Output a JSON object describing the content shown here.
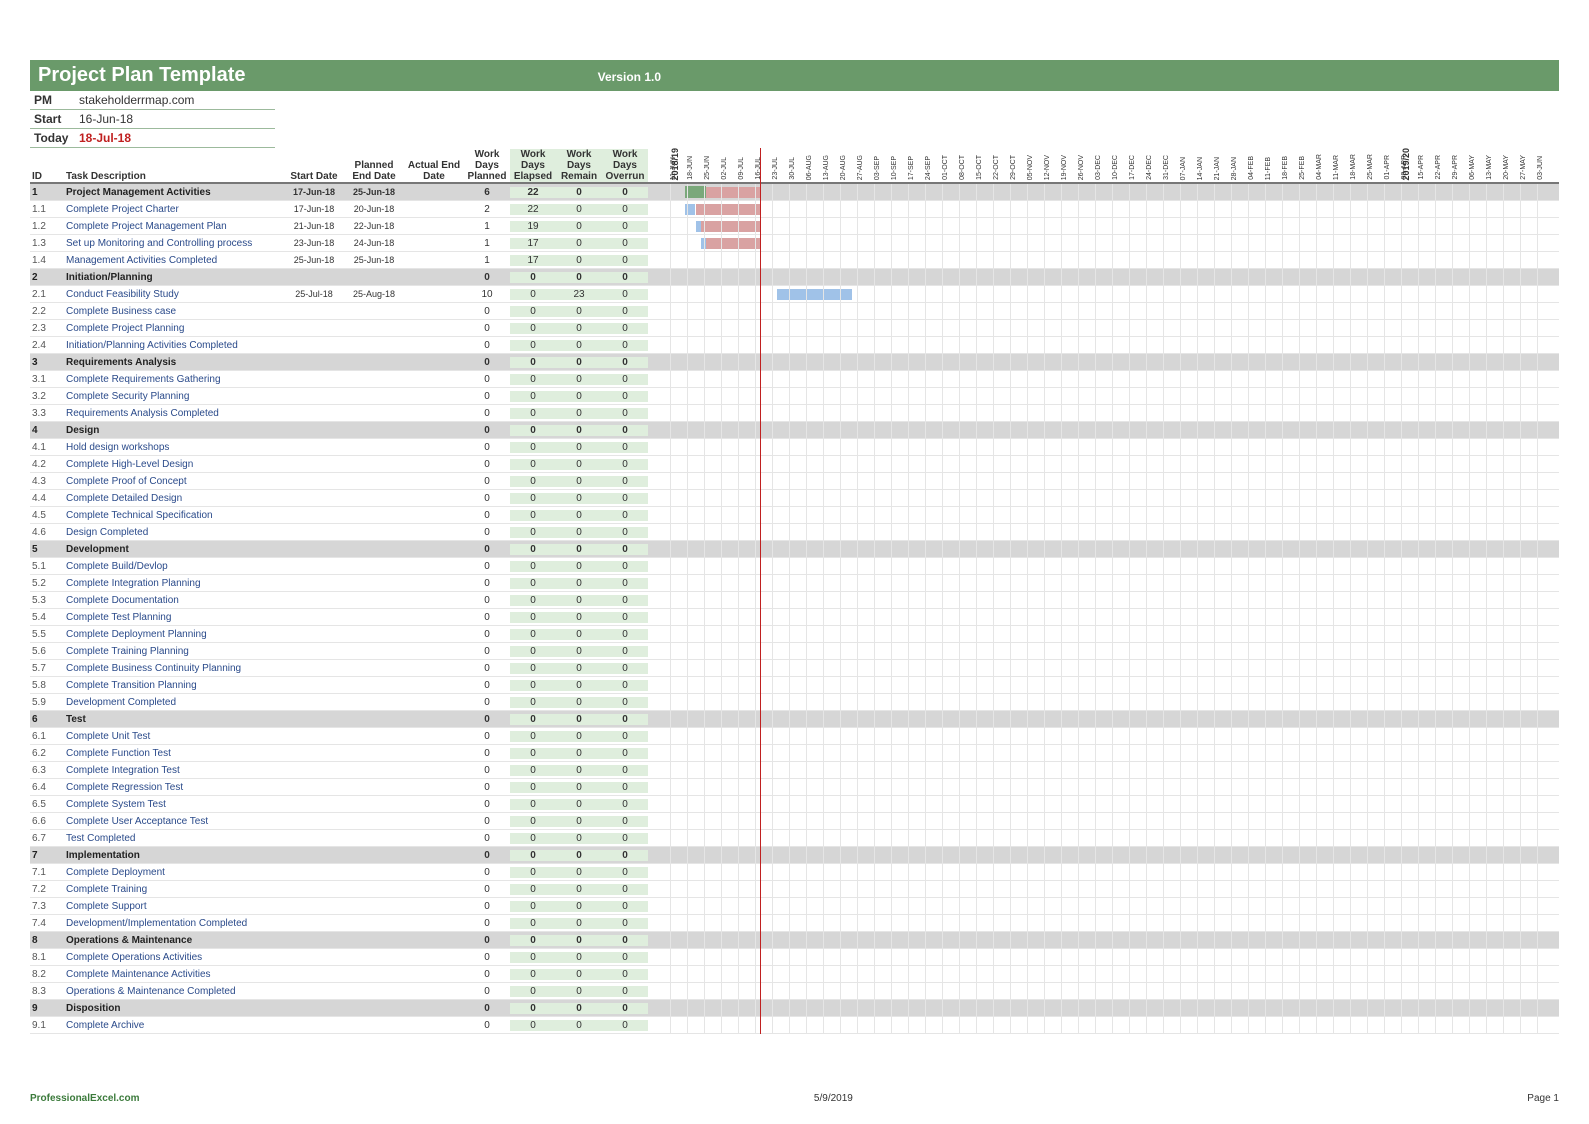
{
  "title": "Project Plan Template",
  "version": "Version 1.0",
  "meta": {
    "pm_label": "PM",
    "pm_value": "stakeholderrmap.com",
    "start_label": "Start",
    "start_value": "16-Jun-18",
    "today_label": "Today",
    "today_value": "18-Jul-18"
  },
  "headers": {
    "id": "ID",
    "desc": "Task Description",
    "start": "Start Date",
    "planned_end": "Planned End Date",
    "actual_end": "Actual End Date",
    "wdp": "Work Days Planned",
    "wde": "Work Days Elapsed",
    "wdr": "Work Days Remain",
    "wdo": "Work Days Overrun"
  },
  "timeline": {
    "years": [
      {
        "label": "2018/19",
        "weekIndex": 0
      },
      {
        "label": "2019/20",
        "weekIndex": 43
      }
    ],
    "weeks": [
      "11-JUN",
      "18-JUN",
      "25-JUN",
      "02-JUL",
      "09-JUL",
      "16-JUL",
      "23-JUL",
      "30-JUL",
      "06-AUG",
      "13-AUG",
      "20-AUG",
      "27-AUG",
      "03-SEP",
      "10-SEP",
      "17-SEP",
      "24-SEP",
      "01-OCT",
      "08-OCT",
      "15-OCT",
      "22-OCT",
      "29-OCT",
      "05-NOV",
      "12-NOV",
      "19-NOV",
      "26-NOV",
      "03-DEC",
      "10-DEC",
      "17-DEC",
      "24-DEC",
      "31-DEC",
      "07-JAN",
      "14-JAN",
      "21-JAN",
      "28-JAN",
      "04-FEB",
      "11-FEB",
      "18-FEB",
      "25-FEB",
      "04-MAR",
      "11-MAR",
      "18-MAR",
      "25-MAR",
      "01-APR",
      "08-APR",
      "15-APR",
      "22-APR",
      "29-APR",
      "06-MAY",
      "13-MAY",
      "20-MAY",
      "27-MAY",
      "03-JUN"
    ],
    "weekWidth": 17,
    "todayWeekOffset": 5.3
  },
  "rows": [
    {
      "id": "1",
      "phase": true,
      "desc": "Project Management Activities",
      "sd": "17-Jun-18",
      "ped": "25-Jun-18",
      "aed": "",
      "wp": "6",
      "we": "22",
      "wr": "0",
      "wo": "0",
      "bar": {
        "start": 0.9,
        "len": 1.2,
        "type": "phaseBar"
      },
      "over": {
        "start": 2.1,
        "len": 3.2
      }
    },
    {
      "id": "1.1",
      "phase": false,
      "desc": "Complete Project Charter",
      "sd": "17-Jun-18",
      "ped": "20-Jun-18",
      "aed": "",
      "wp": "2",
      "we": "22",
      "wr": "0",
      "wo": "0",
      "bar": {
        "start": 0.9,
        "len": 0.6,
        "type": "plan"
      },
      "over": {
        "start": 1.5,
        "len": 3.8
      }
    },
    {
      "id": "1.2",
      "phase": false,
      "desc": "Complete Project Management Plan",
      "sd": "21-Jun-18",
      "ped": "22-Jun-18",
      "aed": "",
      "wp": "1",
      "we": "19",
      "wr": "0",
      "wo": "0",
      "bar": {
        "start": 1.5,
        "len": 0.3,
        "type": "plan"
      },
      "over": {
        "start": 1.8,
        "len": 3.5
      }
    },
    {
      "id": "1.3",
      "phase": false,
      "desc": "Set up Monitoring and Controlling process",
      "sd": "23-Jun-18",
      "ped": "24-Jun-18",
      "aed": "",
      "wp": "1",
      "we": "17",
      "wr": "0",
      "wo": "0",
      "bar": {
        "start": 1.8,
        "len": 0.3,
        "type": "plan"
      },
      "over": {
        "start": 2.1,
        "len": 3.2
      }
    },
    {
      "id": "1.4",
      "phase": false,
      "desc": "Management Activities Completed",
      "sd": "25-Jun-18",
      "ped": "25-Jun-18",
      "aed": "",
      "wp": "1",
      "we": "17",
      "wr": "0",
      "wo": "0"
    },
    {
      "id": "2",
      "phase": true,
      "desc": "Initiation/Planning",
      "sd": "",
      "ped": "",
      "aed": "",
      "wp": "0",
      "we": "0",
      "wr": "0",
      "wo": "0"
    },
    {
      "id": "2.1",
      "phase": false,
      "desc": "Conduct Feasibility Study",
      "sd": "25-Jul-18",
      "ped": "25-Aug-18",
      "aed": "",
      "wp": "10",
      "we": "0",
      "wr": "23",
      "wo": "0",
      "bar": {
        "start": 6.3,
        "len": 4.4,
        "type": "plan"
      }
    },
    {
      "id": "2.2",
      "phase": false,
      "desc": "Complete Business case",
      "sd": "",
      "ped": "",
      "aed": "",
      "wp": "0",
      "we": "0",
      "wr": "0",
      "wo": "0"
    },
    {
      "id": "2.3",
      "phase": false,
      "desc": "Complete Project Planning",
      "sd": "",
      "ped": "",
      "aed": "",
      "wp": "0",
      "we": "0",
      "wr": "0",
      "wo": "0"
    },
    {
      "id": "2.4",
      "phase": false,
      "desc": "Initiation/Planning Activities Completed",
      "sd": "",
      "ped": "",
      "aed": "",
      "wp": "0",
      "we": "0",
      "wr": "0",
      "wo": "0"
    },
    {
      "id": "3",
      "phase": true,
      "desc": "Requirements Analysis",
      "sd": "",
      "ped": "",
      "aed": "",
      "wp": "0",
      "we": "0",
      "wr": "0",
      "wo": "0"
    },
    {
      "id": "3.1",
      "phase": false,
      "desc": "Complete Requirements Gathering",
      "sd": "",
      "ped": "",
      "aed": "",
      "wp": "0",
      "we": "0",
      "wr": "0",
      "wo": "0"
    },
    {
      "id": "3.2",
      "phase": false,
      "desc": "Complete Security Planning",
      "sd": "",
      "ped": "",
      "aed": "",
      "wp": "0",
      "we": "0",
      "wr": "0",
      "wo": "0"
    },
    {
      "id": "3.3",
      "phase": false,
      "desc": "Requirements Analysis Completed",
      "sd": "",
      "ped": "",
      "aed": "",
      "wp": "0",
      "we": "0",
      "wr": "0",
      "wo": "0"
    },
    {
      "id": "4",
      "phase": true,
      "desc": "Design",
      "sd": "",
      "ped": "",
      "aed": "",
      "wp": "0",
      "we": "0",
      "wr": "0",
      "wo": "0"
    },
    {
      "id": "4.1",
      "phase": false,
      "desc": "Hold design workshops",
      "sd": "",
      "ped": "",
      "aed": "",
      "wp": "0",
      "we": "0",
      "wr": "0",
      "wo": "0"
    },
    {
      "id": "4.2",
      "phase": false,
      "desc": "Complete High-Level Design",
      "sd": "",
      "ped": "",
      "aed": "",
      "wp": "0",
      "we": "0",
      "wr": "0",
      "wo": "0"
    },
    {
      "id": "4.3",
      "phase": false,
      "desc": "Complete Proof of Concept",
      "sd": "",
      "ped": "",
      "aed": "",
      "wp": "0",
      "we": "0",
      "wr": "0",
      "wo": "0"
    },
    {
      "id": "4.4",
      "phase": false,
      "desc": "Complete Detailed Design",
      "sd": "",
      "ped": "",
      "aed": "",
      "wp": "0",
      "we": "0",
      "wr": "0",
      "wo": "0"
    },
    {
      "id": "4.5",
      "phase": false,
      "desc": "Complete Technical Specification",
      "sd": "",
      "ped": "",
      "aed": "",
      "wp": "0",
      "we": "0",
      "wr": "0",
      "wo": "0"
    },
    {
      "id": "4.6",
      "phase": false,
      "desc": "Design Completed",
      "sd": "",
      "ped": "",
      "aed": "",
      "wp": "0",
      "we": "0",
      "wr": "0",
      "wo": "0"
    },
    {
      "id": "5",
      "phase": true,
      "desc": "Development",
      "sd": "",
      "ped": "",
      "aed": "",
      "wp": "0",
      "we": "0",
      "wr": "0",
      "wo": "0"
    },
    {
      "id": "5.1",
      "phase": false,
      "desc": "Complete Build/Devlop",
      "sd": "",
      "ped": "",
      "aed": "",
      "wp": "0",
      "we": "0",
      "wr": "0",
      "wo": "0"
    },
    {
      "id": "5.2",
      "phase": false,
      "desc": "Complete Integration Planning",
      "sd": "",
      "ped": "",
      "aed": "",
      "wp": "0",
      "we": "0",
      "wr": "0",
      "wo": "0"
    },
    {
      "id": "5.3",
      "phase": false,
      "desc": "Complete Documentation",
      "sd": "",
      "ped": "",
      "aed": "",
      "wp": "0",
      "we": "0",
      "wr": "0",
      "wo": "0"
    },
    {
      "id": "5.4",
      "phase": false,
      "desc": "Complete Test Planning",
      "sd": "",
      "ped": "",
      "aed": "",
      "wp": "0",
      "we": "0",
      "wr": "0",
      "wo": "0"
    },
    {
      "id": "5.5",
      "phase": false,
      "desc": "Complete Deployment Planning",
      "sd": "",
      "ped": "",
      "aed": "",
      "wp": "0",
      "we": "0",
      "wr": "0",
      "wo": "0"
    },
    {
      "id": "5.6",
      "phase": false,
      "desc": "Complete Training Planning",
      "sd": "",
      "ped": "",
      "aed": "",
      "wp": "0",
      "we": "0",
      "wr": "0",
      "wo": "0"
    },
    {
      "id": "5.7",
      "phase": false,
      "desc": "Complete Business Continuity Planning",
      "sd": "",
      "ped": "",
      "aed": "",
      "wp": "0",
      "we": "0",
      "wr": "0",
      "wo": "0"
    },
    {
      "id": "5.8",
      "phase": false,
      "desc": "Complete Transition Planning",
      "sd": "",
      "ped": "",
      "aed": "",
      "wp": "0",
      "we": "0",
      "wr": "0",
      "wo": "0"
    },
    {
      "id": "5.9",
      "phase": false,
      "desc": "Development Completed",
      "sd": "",
      "ped": "",
      "aed": "",
      "wp": "0",
      "we": "0",
      "wr": "0",
      "wo": "0"
    },
    {
      "id": "6",
      "phase": true,
      "desc": "Test",
      "sd": "",
      "ped": "",
      "aed": "",
      "wp": "0",
      "we": "0",
      "wr": "0",
      "wo": "0"
    },
    {
      "id": "6.1",
      "phase": false,
      "desc": "Complete Unit Test",
      "sd": "",
      "ped": "",
      "aed": "",
      "wp": "0",
      "we": "0",
      "wr": "0",
      "wo": "0"
    },
    {
      "id": "6.2",
      "phase": false,
      "desc": "Complete Function Test",
      "sd": "",
      "ped": "",
      "aed": "",
      "wp": "0",
      "we": "0",
      "wr": "0",
      "wo": "0"
    },
    {
      "id": "6.3",
      "phase": false,
      "desc": "Complete Integration Test",
      "sd": "",
      "ped": "",
      "aed": "",
      "wp": "0",
      "we": "0",
      "wr": "0",
      "wo": "0"
    },
    {
      "id": "6.4",
      "phase": false,
      "desc": "Complete Regression Test",
      "sd": "",
      "ped": "",
      "aed": "",
      "wp": "0",
      "we": "0",
      "wr": "0",
      "wo": "0"
    },
    {
      "id": "6.5",
      "phase": false,
      "desc": "Complete System Test",
      "sd": "",
      "ped": "",
      "aed": "",
      "wp": "0",
      "we": "0",
      "wr": "0",
      "wo": "0"
    },
    {
      "id": "6.6",
      "phase": false,
      "desc": "Complete User Acceptance Test",
      "sd": "",
      "ped": "",
      "aed": "",
      "wp": "0",
      "we": "0",
      "wr": "0",
      "wo": "0"
    },
    {
      "id": "6.7",
      "phase": false,
      "desc": "Test Completed",
      "sd": "",
      "ped": "",
      "aed": "",
      "wp": "0",
      "we": "0",
      "wr": "0",
      "wo": "0"
    },
    {
      "id": "7",
      "phase": true,
      "desc": "Implementation",
      "sd": "",
      "ped": "",
      "aed": "",
      "wp": "0",
      "we": "0",
      "wr": "0",
      "wo": "0"
    },
    {
      "id": "7.1",
      "phase": false,
      "desc": "Complete Deployment",
      "sd": "",
      "ped": "",
      "aed": "",
      "wp": "0",
      "we": "0",
      "wr": "0",
      "wo": "0"
    },
    {
      "id": "7.2",
      "phase": false,
      "desc": "Complete Training",
      "sd": "",
      "ped": "",
      "aed": "",
      "wp": "0",
      "we": "0",
      "wr": "0",
      "wo": "0"
    },
    {
      "id": "7.3",
      "phase": false,
      "desc": "Complete  Support",
      "sd": "",
      "ped": "",
      "aed": "",
      "wp": "0",
      "we": "0",
      "wr": "0",
      "wo": "0"
    },
    {
      "id": "7.4",
      "phase": false,
      "desc": "Development/Implementation Completed",
      "sd": "",
      "ped": "",
      "aed": "",
      "wp": "0",
      "we": "0",
      "wr": "0",
      "wo": "0"
    },
    {
      "id": "8",
      "phase": true,
      "desc": "Operations & Maintenance",
      "sd": "",
      "ped": "",
      "aed": "",
      "wp": "0",
      "we": "0",
      "wr": "0",
      "wo": "0"
    },
    {
      "id": "8.1",
      "phase": false,
      "desc": "Complete Operations Activities",
      "sd": "",
      "ped": "",
      "aed": "",
      "wp": "0",
      "we": "0",
      "wr": "0",
      "wo": "0"
    },
    {
      "id": "8.2",
      "phase": false,
      "desc": "Complete Maintenance Activities",
      "sd": "",
      "ped": "",
      "aed": "",
      "wp": "0",
      "we": "0",
      "wr": "0",
      "wo": "0"
    },
    {
      "id": "8.3",
      "phase": false,
      "desc": "Operations & Maintenance Completed",
      "sd": "",
      "ped": "",
      "aed": "",
      "wp": "0",
      "we": "0",
      "wr": "0",
      "wo": "0"
    },
    {
      "id": "9",
      "phase": true,
      "desc": "Disposition",
      "sd": "",
      "ped": "",
      "aed": "",
      "wp": "0",
      "we": "0",
      "wr": "0",
      "wo": "0"
    },
    {
      "id": "9.1",
      "phase": false,
      "desc": "Complete Archive",
      "sd": "",
      "ped": "",
      "aed": "",
      "wp": "0",
      "we": "0",
      "wr": "0",
      "wo": "0"
    }
  ],
  "footer": {
    "site": "ProfessionalExcel.com",
    "date": "5/9/2019",
    "page": "Page 1"
  }
}
